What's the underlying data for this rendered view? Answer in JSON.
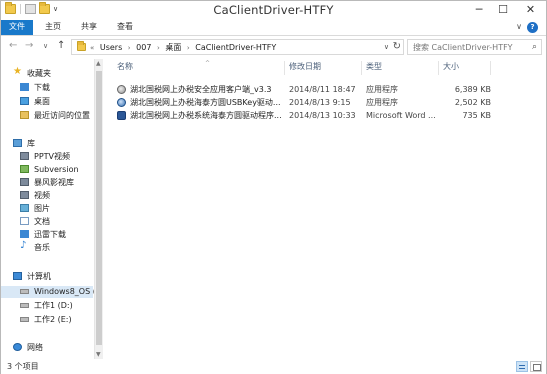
{
  "window": {
    "title": "CaClientDriver-HTFY",
    "min": "─",
    "max": "☐",
    "close": "✕"
  },
  "ribbon": {
    "tabs": [
      "文件",
      "主页",
      "共享",
      "查看"
    ],
    "help": "?",
    "expand": "∨",
    "accent": "#1979ca"
  },
  "address": {
    "crumbs": [
      "«",
      "Users",
      "›",
      "007",
      "›",
      "桌面",
      "›",
      "CaClientDriver-HTFY"
    ],
    "search_placeholder": "搜索 CaClientDriver-HTFY"
  },
  "nav": {
    "back": "←",
    "forward": "→",
    "recent": "∨",
    "up": "↑",
    "dropdown": "∨",
    "refresh": "↻",
    "search_icon": "⌕"
  },
  "sidebar": {
    "favorites": "收藏夹",
    "downloads": "下载",
    "desktop": "桌面",
    "recent_places": "最近访问的位置",
    "libraries": "库",
    "pptv": "PPTV视频",
    "subversion": "Subversion",
    "baofeng": "暴风影视库",
    "videos": "视频",
    "pictures": "图片",
    "documents": "文档",
    "xunlei": "迅雷下载",
    "music": "音乐",
    "computer": "计算机",
    "windows_os": "Windows8_OS (",
    "work1": "工作1 (D:)",
    "work2": "工作2 (E:)",
    "network": "网络",
    "star": "★",
    "note": "♪"
  },
  "columns": {
    "name": "名称",
    "modified": "修改日期",
    "type": "类型",
    "size": "大小",
    "sort_caret": "^"
  },
  "files": [
    {
      "name": "湖北国税网上办税安全应用客户端_v3.3",
      "modified": "2014/8/11 18:47",
      "type": "应用程序",
      "size": "6,389 KB",
      "icon": "setup-icon"
    },
    {
      "name": "湖北国税网上办税海泰方圆USBKey驱动...",
      "modified": "2014/8/13 9:15",
      "type": "应用程序",
      "size": "2,502 KB",
      "icon": "usb-key-icon"
    },
    {
      "name": "湖北国税网上办税系统海泰方圆驱动程序...",
      "modified": "2014/8/13 10:33",
      "type": "Microsoft Word ...",
      "size": "735 KB",
      "icon": "word-doc-icon"
    }
  ],
  "status": {
    "count": "3 个项目"
  }
}
